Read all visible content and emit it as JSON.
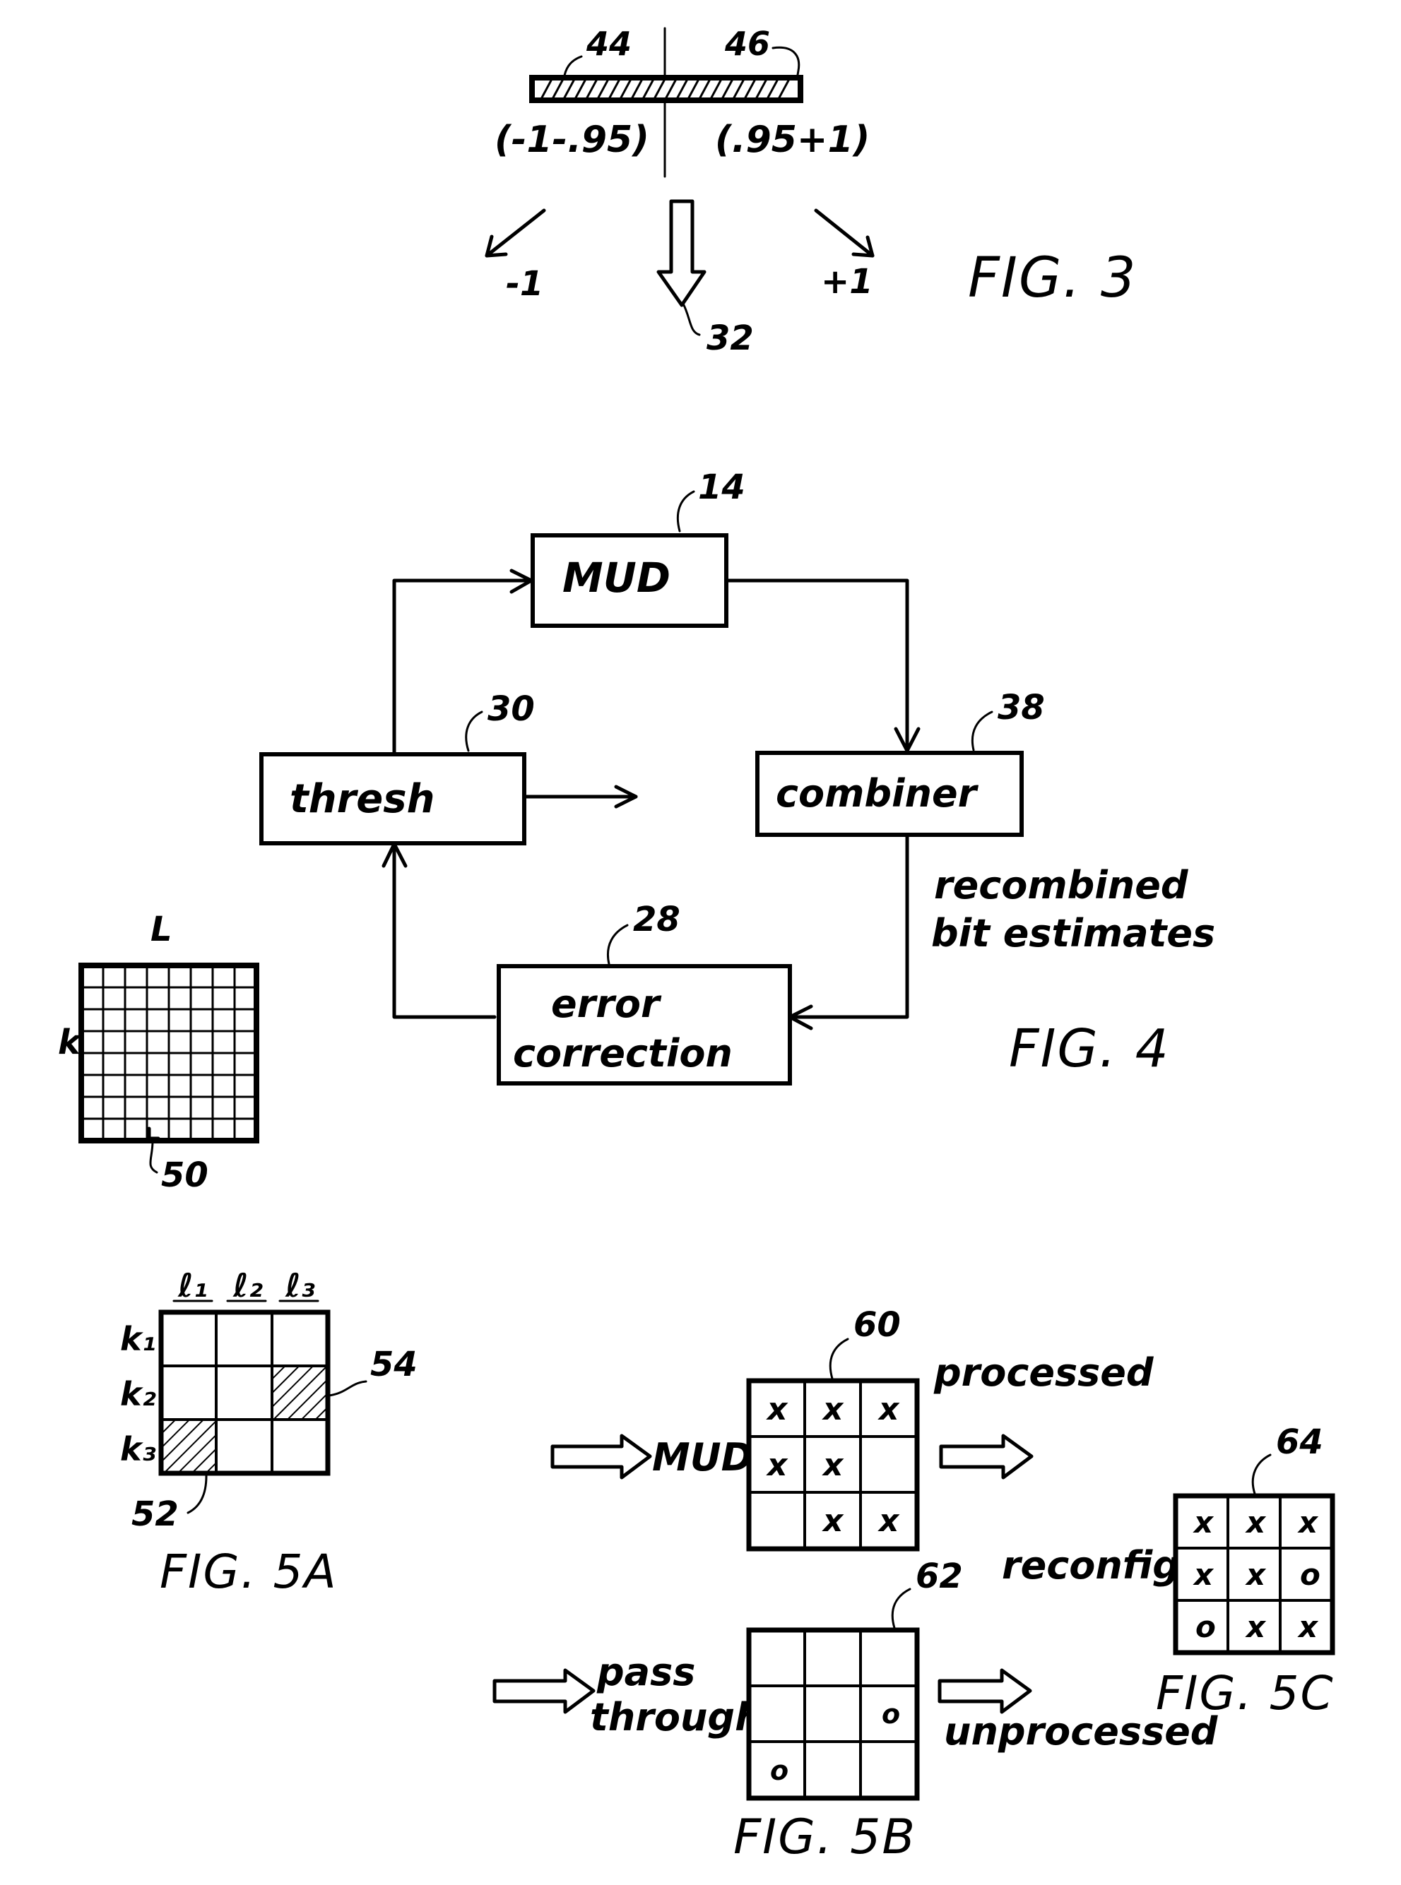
{
  "document": {
    "type": "patent-drawing-sheet",
    "background": "#ffffff",
    "ink": "#000000"
  },
  "fig3": {
    "label": "FIG. 3",
    "ref_left": "44",
    "ref_right": "46",
    "range_left": "(-1-.95)",
    "range_right": "(.95+1)",
    "out_left": "-1",
    "out_right": "+1",
    "ref_arrow": "32",
    "bar_segments": 24
  },
  "fig4": {
    "label": "FIG. 4",
    "blocks": [
      {
        "id": "mud",
        "text": "MUD",
        "ref": "14"
      },
      {
        "id": "thresh",
        "text": "thresh",
        "ref": "30"
      },
      {
        "id": "comb",
        "text": "combiner",
        "ref": "38"
      },
      {
        "id": "errcor",
        "text": "error correction",
        "line1": "error",
        "line2": "correction",
        "ref": "28"
      }
    ],
    "annotation_line1": "recombined",
    "annotation_line2": "bit estimates",
    "grid": {
      "col_label": "L",
      "row_label": "k",
      "ref": "50",
      "rows": 8,
      "cols": 8
    }
  },
  "fig5a": {
    "label": "FIG. 5A",
    "col_headers": [
      "ℓ₁",
      "ℓ₂",
      "ℓ₃"
    ],
    "row_headers": [
      "k₁",
      "k₂",
      "k₃"
    ],
    "ref_hatch_top": "54",
    "ref_hatch_bottom": "52",
    "cells": [
      [
        "",
        "",
        ""
      ],
      [
        "",
        "",
        "hatch"
      ],
      [
        "hatch",
        "",
        ""
      ]
    ]
  },
  "fig5b": {
    "label": "FIG. 5B",
    "top_input_label": "MUD",
    "top_output_label": "processed",
    "top_ref": "60",
    "bottom_input_line1": "pass",
    "bottom_input_line2": "through",
    "bottom_output_label": "unprocessed",
    "bottom_ref": "62",
    "top_cells": [
      [
        "x",
        "x",
        "x"
      ],
      [
        "x",
        "x",
        ""
      ],
      [
        "",
        "x",
        "x"
      ]
    ],
    "bottom_cells": [
      [
        "",
        "",
        ""
      ],
      [
        "",
        "",
        "o"
      ],
      [
        "o",
        "",
        ""
      ]
    ]
  },
  "fig5c": {
    "label": "FIG. 5C",
    "arrow_label": "reconfig",
    "ref": "64",
    "cells": [
      [
        "x",
        "x",
        "x"
      ],
      [
        "x",
        "x",
        "o"
      ],
      [
        "o",
        "x",
        "x"
      ]
    ]
  }
}
